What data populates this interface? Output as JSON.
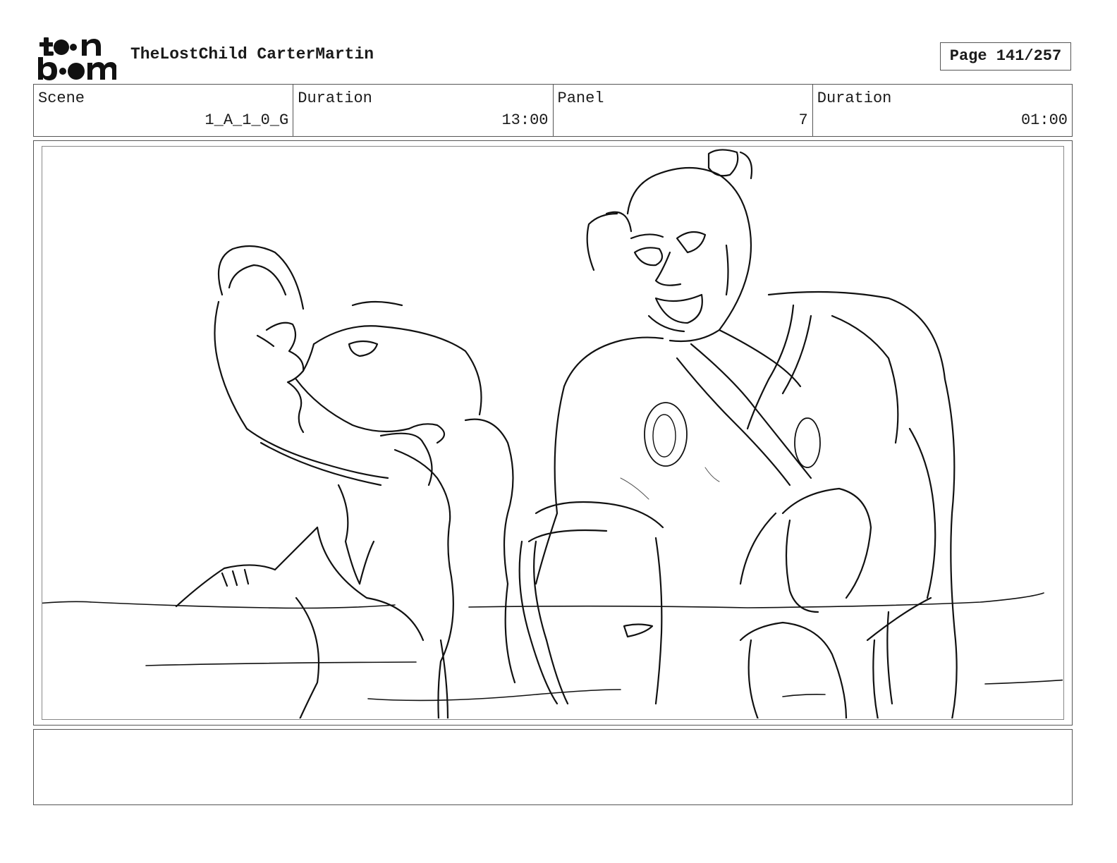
{
  "header": {
    "logo_icon": "toon-boom-logo-icon",
    "project_title": "TheLostChild CarterMartin",
    "page_number": "Page 141/257"
  },
  "info_bar": {
    "scene_label": "Scene",
    "scene_value": "1_A_1_0_G",
    "scene_duration_label": "Duration",
    "scene_duration_value": "13:00",
    "panel_label": "Panel",
    "panel_value": "7",
    "panel_duration_label": "Duration",
    "panel_duration_value": "01:00"
  },
  "panel": {
    "image_icon": "storyboard-sketch-image"
  },
  "notes": {
    "text": ""
  }
}
